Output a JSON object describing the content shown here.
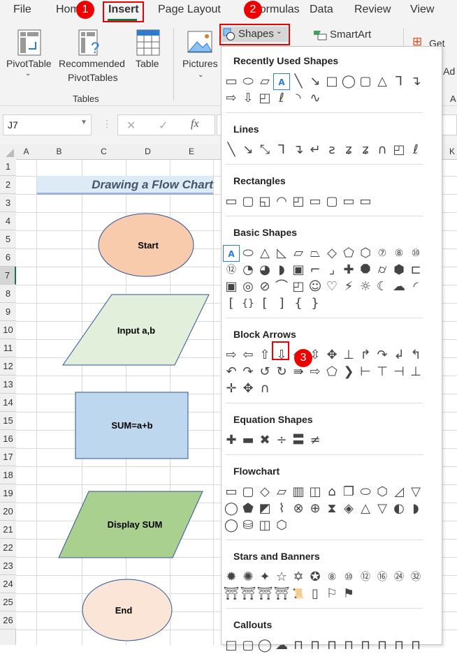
{
  "tabs": [
    "File",
    "Home",
    "Insert",
    "Page Layout",
    "Formulas",
    "Data",
    "Review",
    "View"
  ],
  "active_tab": "Insert",
  "badges": [
    "1",
    "2",
    "3"
  ],
  "ribbon": {
    "pivottable": "PivotTable",
    "recommended1": "Recommended",
    "recommended2": "PivotTables",
    "table": "Table",
    "group_tables": "Tables",
    "pictures": "Pictures",
    "shapes": "Shapes",
    "smartart": "SmartArt",
    "get_addins": "Get Ad",
    "my_addins": "y Ad",
    "addins_group": "A"
  },
  "formula_bar": {
    "name_box": "J7",
    "fx": "fx",
    "cancel": "✕",
    "enter": "✓"
  },
  "columns": [
    "A",
    "B",
    "C",
    "D",
    "E",
    "K"
  ],
  "rows": [
    "1",
    "2",
    "3",
    "4",
    "5",
    "6",
    "7",
    "8",
    "9",
    "10",
    "11",
    "12",
    "13",
    "14",
    "15",
    "16",
    "17",
    "18",
    "19",
    "20",
    "21",
    "22",
    "23",
    "24",
    "25",
    "26"
  ],
  "sheet": {
    "title": "Drawing a Flow Chart",
    "start": "Start",
    "input": "Input a,b",
    "sum": "SUM=a+b",
    "display": "Display SUM",
    "end": "End"
  },
  "flow_colors": {
    "start": "#f8cbad",
    "input": "#e2efda",
    "sum": "#bdd7ee",
    "display": "#a9d08e",
    "end": "#fbe5d6"
  },
  "menu": {
    "sections": [
      {
        "title": "Recently Used Shapes",
        "rows": [
          [
            "▭",
            "⬭",
            "▱",
            "A",
            "╲",
            "↘",
            "□",
            "◯",
            "▢",
            "△",
            "⅂",
            "↴"
          ],
          [
            "⇨",
            "⇩",
            "◰",
            "ℓ",
            "◝",
            "∿"
          ]
        ]
      },
      {
        "title": "Lines",
        "rows": [
          [
            "╲",
            "↘",
            "⤡",
            "⅂",
            "↴",
            "↵",
            "ƨ",
            "ʑ",
            "ʑ",
            "∩",
            "◰",
            "ℓ"
          ]
        ]
      },
      {
        "title": "Rectangles",
        "rows": [
          [
            "▭",
            "▢",
            "◱",
            "◠",
            "◰",
            "▭",
            "▢",
            "▭",
            "▭"
          ]
        ]
      },
      {
        "title": "Basic Shapes",
        "rows": [
          [
            "A",
            "⬭",
            "△",
            "◺",
            "▱",
            "⏢",
            "◇",
            "⬠",
            "⬡",
            "⑦",
            "⑧",
            "⑩"
          ],
          [
            "⑫",
            "◔",
            "◕",
            "◗",
            "▣",
            "⌐",
            "⌟",
            "✚",
            "⯃",
            "⌭",
            "⬢",
            "⊏"
          ],
          [
            "▣",
            "◎",
            "⊘",
            "⌒",
            "◰",
            "☺",
            "♡",
            "⚡",
            "☼",
            "☾",
            "☁",
            "◜"
          ],
          [
            "[",
            "{}",
            "[",
            "]",
            "{",
            "}"
          ]
        ]
      },
      {
        "title": "Block Arrows",
        "rows": [
          [
            "⇨",
            "⇦",
            "⇧",
            "⇩",
            "⬄",
            "⇳",
            "✥",
            "⊥",
            "↱",
            "↷",
            "↲",
            "↰"
          ],
          [
            "↶",
            "↷",
            "↺",
            "↻",
            "⇛",
            "⇨",
            "⬠",
            "❯",
            "⊢",
            "⊤",
            "⊣",
            "⊥"
          ],
          [
            "✛",
            "✥",
            "∩"
          ]
        ]
      },
      {
        "title": "Equation Shapes",
        "rows": [
          [
            "✚",
            "▬",
            "✖",
            "÷",
            "〓",
            "≠"
          ]
        ]
      },
      {
        "title": "Flowchart",
        "rows": [
          [
            "▭",
            "▢",
            "◇",
            "▱",
            "▥",
            "◫",
            "⌂",
            "❐",
            "⬭",
            "⬡",
            "◿",
            "▽"
          ],
          [
            "◯",
            "⬟",
            "◩",
            "⌇",
            "⊗",
            "⊕",
            "⧗",
            "◈",
            "△",
            "▽",
            "◐",
            "◗"
          ],
          [
            "◯",
            "⛁",
            "◫",
            "⬡"
          ]
        ]
      },
      {
        "title": "Stars and Banners",
        "rows": [
          [
            "✹",
            "✺",
            "✦",
            "☆",
            "✡",
            "✪",
            "⑧",
            "⑩",
            "⑫",
            "⑯",
            "㉔",
            "㉜"
          ],
          [
            "⛩",
            "⛩",
            "⛩",
            "⛩",
            "📜",
            "▯",
            "⚐",
            "⚑"
          ]
        ]
      },
      {
        "title": "Callouts",
        "rows": [
          [
            "□",
            "▢",
            "◯",
            "☁",
            "⊓",
            "⊓",
            "⊓",
            "⊓",
            "⊓",
            "⊓",
            "⊓",
            "⊓"
          ]
        ]
      }
    ]
  }
}
